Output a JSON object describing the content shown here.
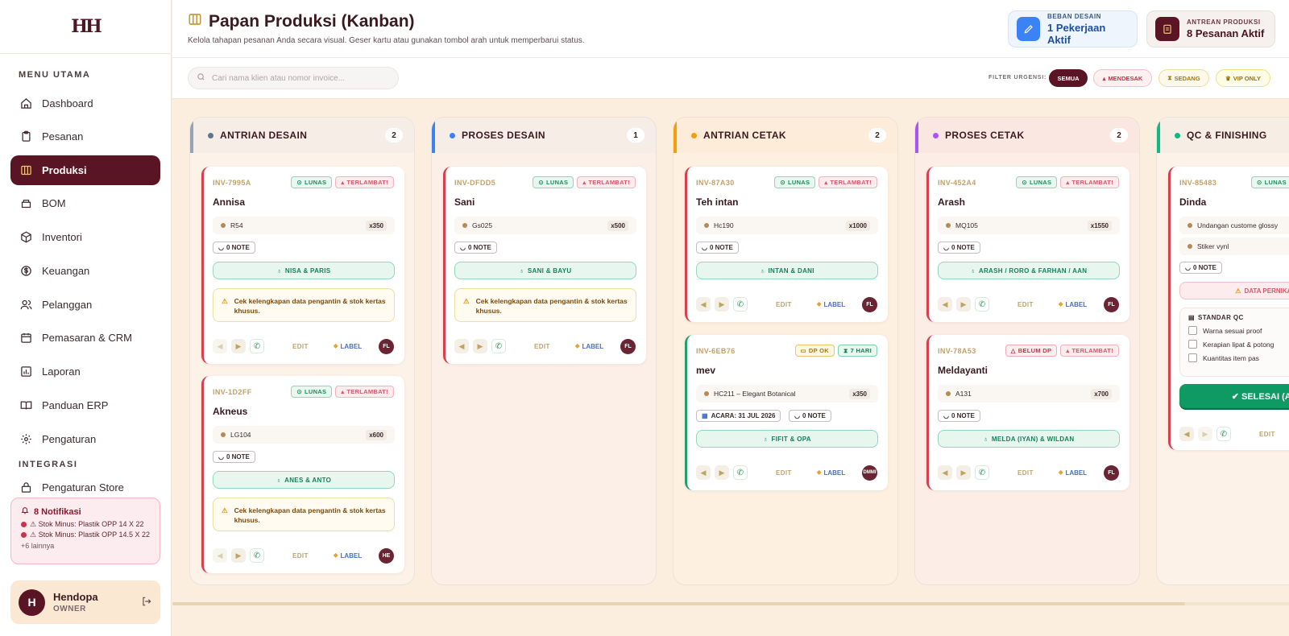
{
  "sidebar": {
    "logo": "HH",
    "menu_title": "MENU UTAMA",
    "items": [
      {
        "label": "Dashboard",
        "icon": "home-icon"
      },
      {
        "label": "Pesanan",
        "icon": "clipboard-icon"
      },
      {
        "label": "Produksi",
        "icon": "columns-icon"
      },
      {
        "label": "BOM",
        "icon": "layers-icon"
      },
      {
        "label": "Inventori",
        "icon": "box-icon"
      },
      {
        "label": "Keuangan",
        "icon": "dollar-icon"
      },
      {
        "label": "Pelanggan",
        "icon": "users-icon"
      },
      {
        "label": "Pemasaran & CRM",
        "icon": "calendar-icon"
      },
      {
        "label": "Laporan",
        "icon": "chart-icon"
      },
      {
        "label": "Panduan ERP",
        "icon": "book-icon"
      },
      {
        "label": "Pengaturan",
        "icon": "gear-icon"
      }
    ],
    "integration_title": "INTEGRASI",
    "integration_items": [
      {
        "label": "Pengaturan Store",
        "icon": "store-icon"
      }
    ],
    "notifications": {
      "title": "8 Notifikasi",
      "lines": [
        "⚠ Stok Minus: Plastik OPP 14 X 22",
        "⚠ Stok Minus: Plastik OPP 14.5 X 22"
      ],
      "more": "+6 lainnya"
    },
    "user": {
      "initial": "H",
      "name": "Hendopa",
      "role": "OWNER"
    }
  },
  "header": {
    "title": "Papan Produksi (Kanban)",
    "subtitle": "Kelola tahapan pesanan Anda secara visual. Geser kartu atau gunakan tombol arah untuk memperbarui status.",
    "stats": [
      {
        "label": "BEBAN DESAIN",
        "value": "1 Pekerjaan Aktif",
        "icon": "pencil-icon",
        "color": "#3b82f6"
      },
      {
        "label": "ANTREAN PRODUKSI",
        "value": "8 Pesanan Aktif",
        "icon": "clipboard-icon",
        "color": "#5a1524"
      }
    ]
  },
  "filters": {
    "search_placeholder": "Cari nama klien atau nomor invoice...",
    "label": "FILTER URGENSI:",
    "chips": [
      "SEMUA",
      "MENDESAK",
      "SEDANG",
      "VIP ONLY"
    ]
  },
  "columns": [
    {
      "title": "ANTRIAN DESAIN",
      "count": "2",
      "color": "#94a3b8",
      "dot": "#64748b"
    },
    {
      "title": "PROSES DESAIN",
      "count": "1",
      "color": "#3b82f6",
      "dot": "#3b82f6"
    },
    {
      "title": "ANTRIAN CETAK",
      "count": "2",
      "color": "#f59e0b",
      "dot": "#f59e0b"
    },
    {
      "title": "PROSES CETAK",
      "count": "2",
      "color": "#a855f7",
      "dot": "#a855f7"
    },
    {
      "title": "QC & FINISHING",
      "count": "",
      "color": "#10b981",
      "dot": "#10b981"
    }
  ],
  "cards": {
    "c1": {
      "inv": "INV-7995A",
      "pay": "LUNAS",
      "status": "TERLAMBAT!",
      "name": "Annisa",
      "product": "R54",
      "qty": "x350",
      "note": "0 NOTE",
      "couple": "NISA & PARIS",
      "warning": "Cek kelengkapan data pengantin & stok kertas khusus.",
      "edit": "EDIT",
      "label": "LABEL",
      "avatar": "FL"
    },
    "c2": {
      "inv": "INV-1D2FF",
      "pay": "LUNAS",
      "status": "TERLAMBAT!",
      "name": "Akneus",
      "product": "LG104",
      "qty": "x600",
      "note": "0 NOTE",
      "couple": "ANES & ANTO",
      "warning": "Cek kelengkapan data pengantin & stok kertas khusus.",
      "edit": "EDIT",
      "label": "LABEL",
      "avatar": "HE"
    },
    "c3": {
      "inv": "INV-DFDD5",
      "pay": "LUNAS",
      "status": "TERLAMBAT!",
      "name": "Sani",
      "product": "Gs025",
      "qty": "x500",
      "note": "0 NOTE",
      "couple": "SANI & BAYU",
      "warning": "Cek kelengkapan data pengantin & stok kertas khusus.",
      "edit": "EDIT",
      "label": "LABEL",
      "avatar": "FL"
    },
    "c4": {
      "inv": "INV-87A30",
      "pay": "LUNAS",
      "status": "TERLAMBAT!",
      "name": "Teh intan",
      "product": "Hc190",
      "qty": "x1000",
      "note": "0 NOTE",
      "couple": "INTAN & DANI",
      "edit": "EDIT",
      "label": "LABEL",
      "avatar": "FL"
    },
    "c5": {
      "inv": "INV-6EB76",
      "pay": "DP OK",
      "status": "7 HARI",
      "name": "mev",
      "product": "HC211 – Elegant Botanical",
      "qty": "x350",
      "acara": "ACARA: 31 JUL 2026",
      "note": "0 NOTE",
      "couple": "FIFIT & OPA",
      "edit": "EDIT",
      "label": "LABEL",
      "avatar": "DMMI"
    },
    "c6": {
      "inv": "INV-452A4",
      "pay": "LUNAS",
      "status": "TERLAMBAT!",
      "name": "Arash",
      "product": "MQ105",
      "qty": "x1550",
      "note": "0 NOTE",
      "couple": "ARASH / RORO & FARHAN / AAN",
      "edit": "EDIT",
      "label": "LABEL",
      "avatar": "FL"
    },
    "c7": {
      "inv": "INV-78A53",
      "pay": "BELUM DP",
      "status": "TERLAMBAT!",
      "name": "Meldayanti",
      "product": "A131",
      "qty": "x700",
      "note": "0 NOTE",
      "couple": "MELDA (IYAN) & WILDAN",
      "edit": "EDIT",
      "label": "LABEL",
      "avatar": "FL"
    },
    "c8": {
      "inv": "INV-85483",
      "pay": "LUNAS",
      "name": "Dinda",
      "product1": "Undangan custome glossy",
      "product2": "Stiker vynl",
      "note": "0 NOTE",
      "warning": "DATA PERNIKAHAN",
      "qc_title": "STANDAR QC",
      "qc_items": [
        "Warna sesuai proof",
        "Kerapian lipat & potong",
        "Kuantitas item pas"
      ],
      "done": "✔ SELESAI (ACTU",
      "edit": "EDIT"
    }
  }
}
